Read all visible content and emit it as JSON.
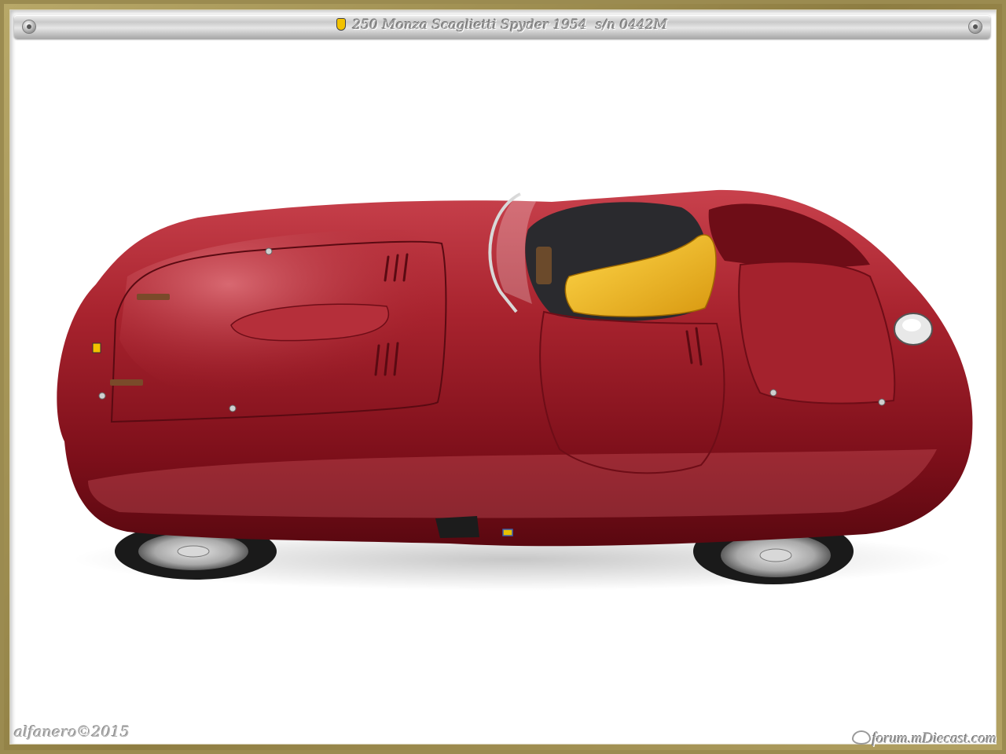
{
  "header": {
    "title": "250 Monza Scaglietti Spyder 1954  s/n 0442M",
    "emblem_icon": "prancing-horse-shield-icon"
  },
  "photo": {
    "car_body_color": "#8b1a24",
    "seat_color": "#f0b820"
  },
  "watermarks": {
    "author": "alfanero©2015",
    "site": "forum.mDiecast.com"
  }
}
